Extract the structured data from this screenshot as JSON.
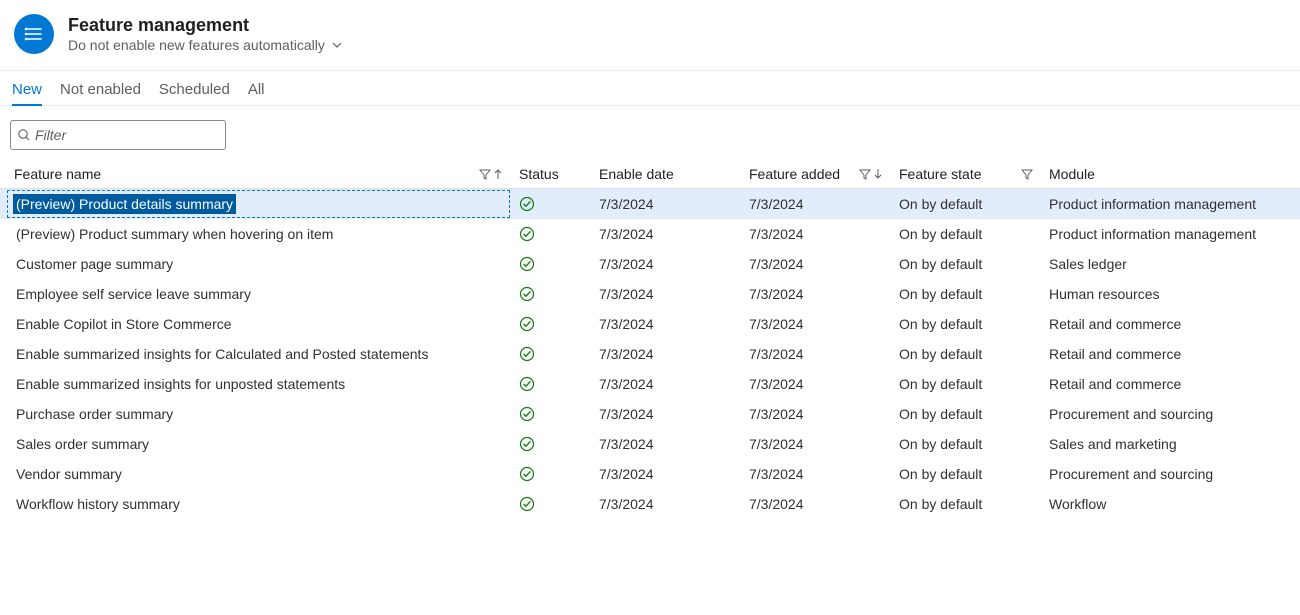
{
  "header": {
    "title": "Feature management",
    "subtitle": "Do not enable new features automatically"
  },
  "tabs": {
    "new": "New",
    "not_enabled": "Not enabled",
    "scheduled": "Scheduled",
    "all": "All"
  },
  "filter": {
    "placeholder": "Filter"
  },
  "columns": {
    "name": "Feature name",
    "status": "Status",
    "enable_date": "Enable date",
    "feature_added": "Feature added",
    "feature_state": "Feature state",
    "module": "Module"
  },
  "rows": [
    {
      "name": "(Preview) Product details summary",
      "status": "enabled",
      "enable_date": "7/3/2024",
      "feature_added": "7/3/2024",
      "feature_state": "On by default",
      "module": "Product information management",
      "selected": true
    },
    {
      "name": "(Preview) Product summary when hovering on item",
      "status": "enabled",
      "enable_date": "7/3/2024",
      "feature_added": "7/3/2024",
      "feature_state": "On by default",
      "module": "Product information management"
    },
    {
      "name": "Customer page summary",
      "status": "enabled",
      "enable_date": "7/3/2024",
      "feature_added": "7/3/2024",
      "feature_state": "On by default",
      "module": "Sales ledger"
    },
    {
      "name": "Employee self service leave summary",
      "status": "enabled",
      "enable_date": "7/3/2024",
      "feature_added": "7/3/2024",
      "feature_state": "On by default",
      "module": "Human resources"
    },
    {
      "name": "Enable Copilot in Store Commerce",
      "status": "enabled",
      "enable_date": "7/3/2024",
      "feature_added": "7/3/2024",
      "feature_state": "On by default",
      "module": "Retail and commerce"
    },
    {
      "name": "Enable summarized insights for Calculated and Posted statements",
      "status": "enabled",
      "enable_date": "7/3/2024",
      "feature_added": "7/3/2024",
      "feature_state": "On by default",
      "module": "Retail and commerce"
    },
    {
      "name": "Enable summarized insights for unposted statements",
      "status": "enabled",
      "enable_date": "7/3/2024",
      "feature_added": "7/3/2024",
      "feature_state": "On by default",
      "module": "Retail and commerce"
    },
    {
      "name": "Purchase order summary",
      "status": "enabled",
      "enable_date": "7/3/2024",
      "feature_added": "7/3/2024",
      "feature_state": "On by default",
      "module": "Procurement and sourcing"
    },
    {
      "name": "Sales order summary",
      "status": "enabled",
      "enable_date": "7/3/2024",
      "feature_added": "7/3/2024",
      "feature_state": "On by default",
      "module": "Sales and marketing"
    },
    {
      "name": "Vendor summary",
      "status": "enabled",
      "enable_date": "7/3/2024",
      "feature_added": "7/3/2024",
      "feature_state": "On by default",
      "module": "Procurement and sourcing"
    },
    {
      "name": "Workflow history summary",
      "status": "enabled",
      "enable_date": "7/3/2024",
      "feature_added": "7/3/2024",
      "feature_state": "On by default",
      "module": "Workflow"
    }
  ]
}
